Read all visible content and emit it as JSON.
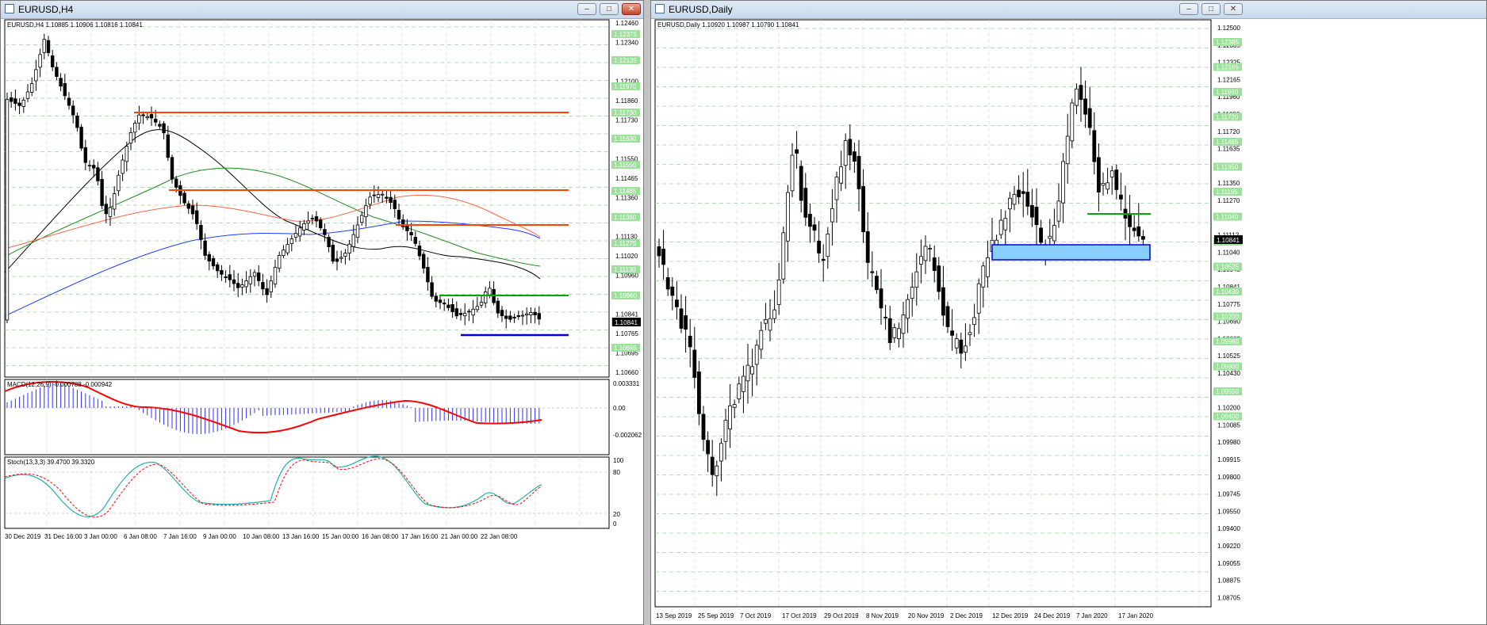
{
  "colors": {
    "up": "#000000",
    "down": "#000000",
    "grid": "#9bd39b",
    "levelGreen": "#9be09b",
    "orange": "#ff4500",
    "blue": "#0000cd",
    "black": "#000000",
    "ma_green": "#228b22",
    "ma_orange": "#ff6347",
    "ma_blue": "#1e3cff",
    "macd_hist": "#3030ff",
    "macd_signal": "#ff0000",
    "stoch_main": "#20b2aa",
    "stoch_signal": "#ff0000",
    "zone": "#87cefa"
  },
  "left": {
    "title": "EURUSD,H4",
    "header": "EURUSD,H4  1.10885 1.10906 1.10816 1.10841",
    "current_price": "1.10841",
    "price_ticks": [
      "1.12460",
      "1.12340",
      "1.12220",
      "1.12100",
      "1.11860",
      "1.11730",
      "1.11630",
      "1.11550",
      "1.11465",
      "1.11360",
      "1.11275",
      "1.11130",
      "1.11020",
      "1.10960",
      "1.10900",
      "1.10841",
      "1.10765",
      "1.10695",
      "1.10660"
    ],
    "level_tags": [
      "1.12375",
      "1.12135",
      "1.11970",
      "1.11730",
      "1.11630",
      "1.11550",
      "1.11465",
      "1.11360",
      "1.11275",
      "1.11130",
      "1.10960",
      "1.10765",
      "1.10695"
    ],
    "time_labels": [
      "30 Dec 2019",
      "31 Dec 16:00",
      "3 Jan 00:00",
      "6 Jan 08:00",
      "7 Jan 16:00",
      "9 Jan 00:00",
      "10 Jan 08:00",
      "13 Jan 16:00",
      "15 Jan 00:00",
      "16 Jan 08:00",
      "17 Jan 16:00",
      "21 Jan 00:00",
      "22 Jan 08:00"
    ],
    "macd_label": "MACD(12,26,9) -0.000788 -0.000942",
    "macd_ticks": [
      "0.003331",
      "0.00",
      "-0.002062"
    ],
    "stoch_label": "Stoch(13,3,3) 39.4700 39.3320",
    "stoch_ticks": [
      "100",
      "80",
      "20",
      "0"
    ]
  },
  "right": {
    "title": "EURUSD,Daily",
    "header": "EURUSD,Daily  1.10920 1.10987 1.10790 1.10841",
    "current_price": "1.10841",
    "price_ticks": [
      "1.12500",
      "1.12385",
      "1.12325",
      "1.12165",
      "1.11960",
      "1.11800",
      "1.11720",
      "1.11635",
      "1.11485",
      "1.11350",
      "1.11270",
      "1.11195",
      "1.11112",
      "1.11040",
      "1.10945",
      "1.10841",
      "1.10775",
      "1.10690",
      "1.10600",
      "1.10525",
      "1.10430",
      "1.10255",
      "1.10200",
      "1.10085",
      "1.09980",
      "1.09915",
      "1.09800",
      "1.09745",
      "1.09550",
      "1.09400",
      "1.09220",
      "1.09055",
      "1.08875",
      "1.08705"
    ],
    "level_tags": [
      "1.12385",
      "1.12165",
      "1.11960",
      "1.11720",
      "1.11485",
      "1.11350",
      "1.11195",
      "1.11040",
      "1.10690",
      "1.10525",
      "1.10430",
      "1.10200",
      "1.09980",
      "1.09800",
      "1.09550",
      "1.09400"
    ],
    "time_labels": [
      "13 Sep 2019",
      "25 Sep 2019",
      "7 Oct 2019",
      "17 Oct 2019",
      "29 Oct 2019",
      "8 Nov 2019",
      "20 Nov 2019",
      "2 Dec 2019",
      "12 Dec 2019",
      "24 Dec 2019",
      "7 Jan 2020",
      "17 Jan 2020"
    ]
  },
  "window_buttons": {
    "minimize": "–",
    "maximize": "□",
    "close": "✕"
  }
}
